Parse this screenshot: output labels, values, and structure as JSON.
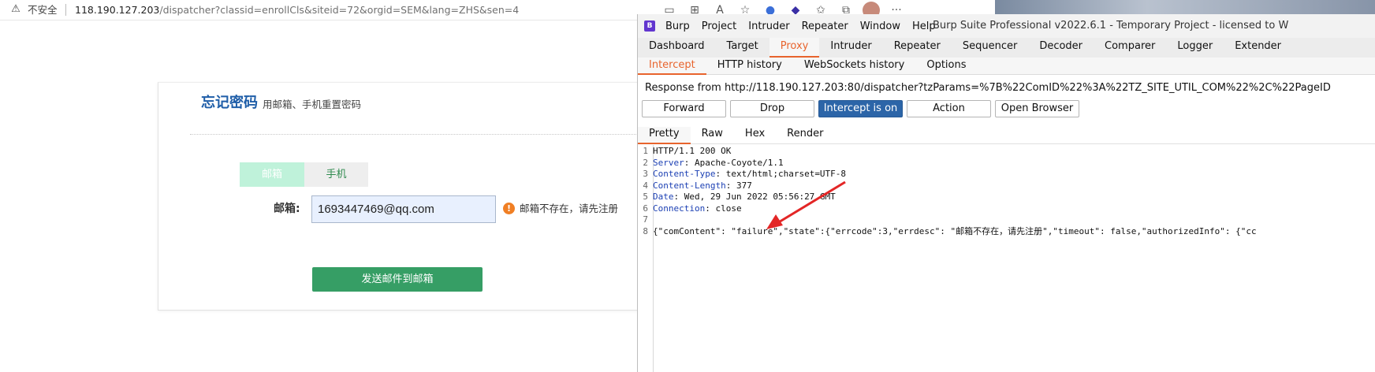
{
  "browser": {
    "insecure_label": "不安全",
    "url_host": "118.190.127.203",
    "url_path": "/dispatcher?classid=enrollCls&siteid=72&orgid=SEM&lang=ZHS&sen=4",
    "warning_glyph": "⚠",
    "toolbar_icons": [
      "tab-icon",
      "apps-icon",
      "read-aloud-icon",
      "favorite-add-icon",
      "extension-icon",
      "collections-icon",
      "favorites-icon",
      "profile-icon",
      "more-icon"
    ],
    "more_glyph": "···"
  },
  "page": {
    "title": "忘记密码",
    "subtitle": "用邮箱、手机重置密码",
    "tab_email": "邮箱",
    "tab_phone": "手机",
    "email_label": "邮箱:",
    "email_value": "1693447469@qq.com",
    "error_glyph": "!",
    "error_message": "邮箱不存在，请先注册",
    "send_button": "发送邮件到邮箱",
    "colors": {
      "title": "#1f5ea8",
      "button": "#369e65",
      "error": "#f07f24"
    }
  },
  "burp": {
    "logo": "B",
    "menu": [
      "Burp",
      "Project",
      "Intruder",
      "Repeater",
      "Window",
      "Help"
    ],
    "app_title": "Burp Suite Professional v2022.6.1 - Temporary Project - licensed to W",
    "main_tabs": [
      "Dashboard",
      "Target",
      "Proxy",
      "Intruder",
      "Repeater",
      "Sequencer",
      "Decoder",
      "Comparer",
      "Logger",
      "Extender"
    ],
    "main_tab_active": "Proxy",
    "sub_tabs": [
      "Intercept",
      "HTTP history",
      "WebSockets history",
      "Options"
    ],
    "sub_tab_active": "Intercept",
    "response_from": "Response from http://118.190.127.203:80/dispatcher?tzParams=%7B%22ComID%22%3A%22TZ_SITE_UTIL_COM%22%2C%22PageID",
    "buttons": {
      "forward": "Forward",
      "drop": "Drop",
      "intercept": "Intercept is on",
      "action": "Action",
      "open_browser": "Open Browser"
    },
    "view_tabs": [
      "Pretty",
      "Raw",
      "Hex",
      "Render"
    ],
    "view_tab_active": "Pretty",
    "response_lines": [
      {
        "n": "1",
        "key": "",
        "val": "HTTP/1.1 200 OK"
      },
      {
        "n": "2",
        "key": "Server",
        "val": ": Apache-Coyote/1.1"
      },
      {
        "n": "3",
        "key": "Content-Type",
        "val": ": text/html;charset=UTF-8"
      },
      {
        "n": "4",
        "key": "Content-Length",
        "val": ": 377"
      },
      {
        "n": "5",
        "key": "Date",
        "val": ": Wed, 29 Jun 2022 05:56:27 GMT"
      },
      {
        "n": "6",
        "key": "Connection",
        "val": ": close"
      },
      {
        "n": "7",
        "key": "",
        "val": ""
      },
      {
        "n": "8",
        "key": "",
        "val": "{\"comContent\": \"failure\",\"state\":{\"errcode\":3,\"errdesc\": \"邮箱不存在，请先注册\",\"timeout\": false,\"authorizedInfo\": {\"cc"
      }
    ],
    "accent_color": "#e8642d",
    "intercept_color": "#2c65a8"
  },
  "annotation": {
    "arrow_color": "#e32626"
  }
}
